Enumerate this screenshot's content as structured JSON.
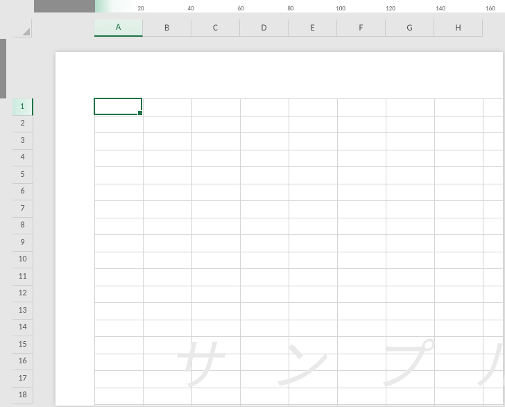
{
  "ruler": {
    "horizontal_labels": [
      "20",
      "40",
      "60",
      "80",
      "100",
      "120",
      "140",
      "160"
    ]
  },
  "columns": {
    "labels": [
      "A",
      "B",
      "C",
      "D",
      "E",
      "F",
      "G",
      "H"
    ],
    "active_index": 0
  },
  "rows": {
    "labels": [
      "1",
      "2",
      "3",
      "4",
      "5",
      "6",
      "7",
      "8",
      "9",
      "10",
      "11",
      "12",
      "13",
      "14",
      "15",
      "16",
      "17",
      "18"
    ],
    "active_index": 0
  },
  "selection": {
    "cell": "A1"
  },
  "watermark": {
    "text": "サンプル"
  }
}
